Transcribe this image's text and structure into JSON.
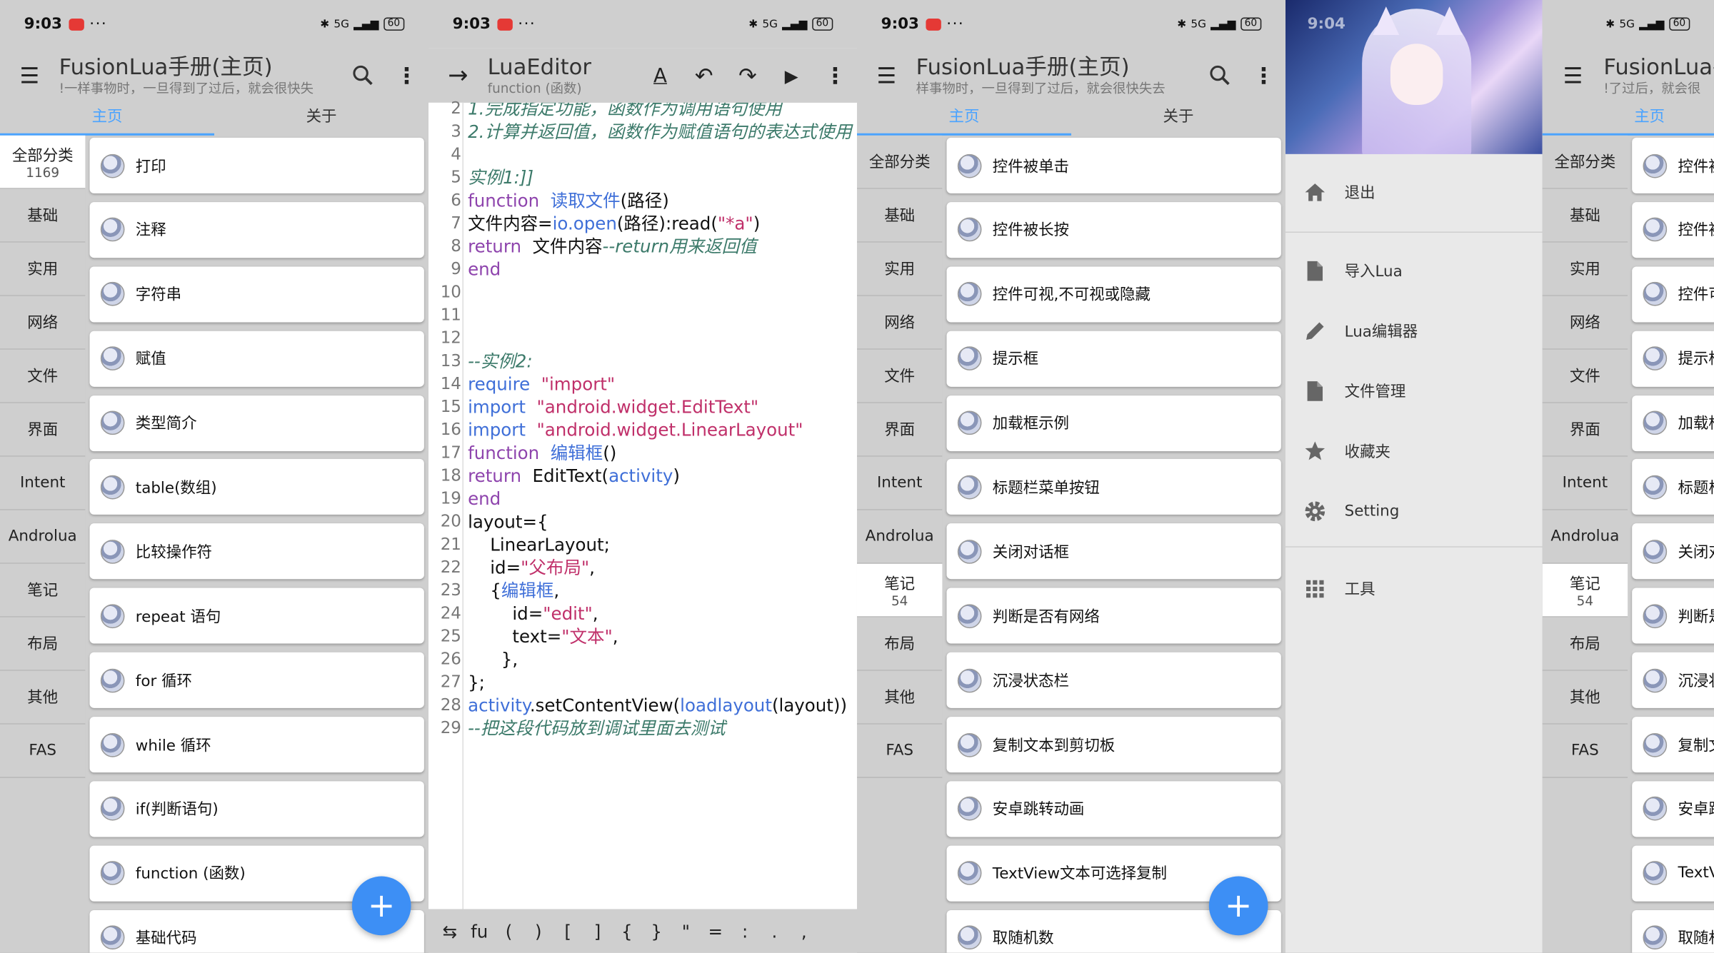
{
  "status": {
    "time": "9:03",
    "time_drawer": "9:04",
    "dots": "···",
    "battery": "60",
    "signal": "5G"
  },
  "main": {
    "title": "FusionLua手册(主页)",
    "subtitle": "!一样事物时，一旦得到了过后，就会很快失",
    "subtitle_p3": "样事物时，一旦得到了过后，就会很快失去",
    "subtitle_p5": "!了过后，就会很",
    "tabs": [
      "主页",
      "关于"
    ],
    "categories": [
      "全部分类",
      "基础",
      "实用",
      "网络",
      "文件",
      "界面",
      "Intent",
      "Androlua",
      "笔记",
      "布局",
      "其他",
      "FAS"
    ],
    "all_count": "1169",
    "notes_count": "54",
    "items_p1": [
      "打印",
      "注释",
      "字符串",
      "赋值",
      "类型简介",
      "table(数组)",
      "比较操作符",
      "repeat 语句",
      "for 循环",
      "while 循环",
      "if(判断语句)",
      "function (函数)",
      "基础代码"
    ],
    "items_p3": [
      "控件被单击",
      "控件被长按",
      "控件可视,不可视或隐藏",
      "提示框",
      "加载框示例",
      "标题栏菜单按钮",
      "关闭对话框",
      "判断是否有网络",
      "沉浸状态栏",
      "复制文本到剪切板",
      "安卓跳转动画",
      "TextView文本可选择复制",
      "取随机数"
    ],
    "items_p5": [
      "控件被",
      "控件被",
      "控件可",
      "提示框",
      "加载框",
      "标题栏",
      "关闭对",
      "判断是",
      "沉浸状",
      "复制文",
      "安卓跳",
      "TextVi",
      "取随机"
    ],
    "fab": "+"
  },
  "editor": {
    "title": "LuaEditor",
    "subtitle": "function (函数)",
    "line_numbers": [
      "2",
      "3",
      "4",
      "5",
      "6",
      "7",
      "8",
      "9",
      "10",
      "11",
      "12",
      "13",
      "14",
      "15",
      "16",
      "17",
      "18",
      "19",
      "20",
      "21",
      "22",
      "23",
      "24",
      "25",
      "26",
      "27",
      "28",
      "29"
    ],
    "symbols": [
      "⇆",
      "fu",
      "(",
      ")",
      "[",
      "]",
      "{",
      "}",
      "\"",
      "=",
      ":",
      ".",
      ","
    ]
  },
  "drawer": {
    "items": [
      {
        "label": "退出",
        "icon": "home-icon"
      },
      {
        "label": "导入Lua",
        "icon": "file-icon"
      },
      {
        "label": "Lua编辑器",
        "icon": "pencil-icon"
      },
      {
        "label": "文件管理",
        "icon": "file-icon"
      },
      {
        "label": "收藏夹",
        "icon": "star-icon"
      },
      {
        "label": "Setting",
        "icon": "gear-icon"
      },
      {
        "label": "工具",
        "icon": "apps-grid-icon"
      }
    ]
  },
  "colors": {
    "accent": "#4aa3ff",
    "fab": "#3d8ff5",
    "panel": "#cfcfcf"
  }
}
